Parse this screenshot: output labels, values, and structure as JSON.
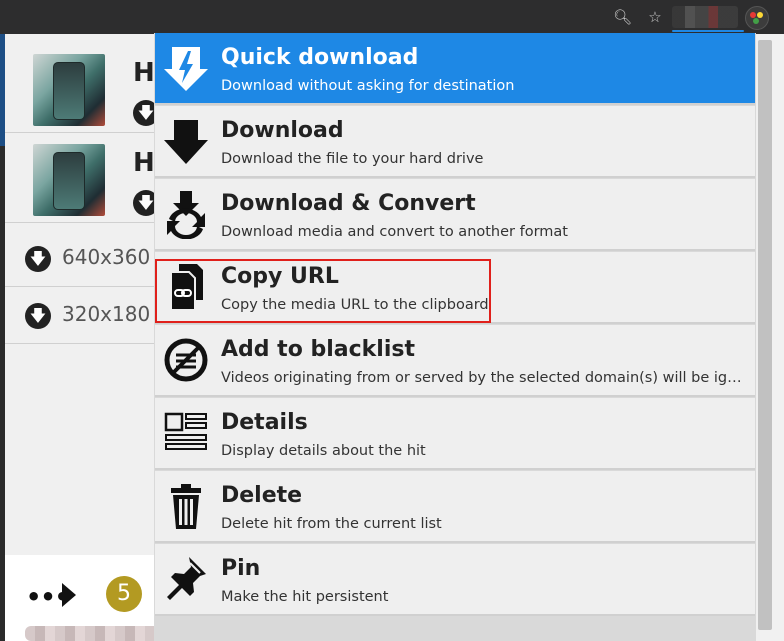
{
  "hits": [
    {
      "letter": "H"
    },
    {
      "letter": "H"
    }
  ],
  "variants": [
    {
      "label": "640x360"
    },
    {
      "label": "320x180"
    }
  ],
  "footer": {
    "badge_count": "5"
  },
  "menu": {
    "items": [
      {
        "title": "Quick download",
        "desc": "Download without asking for destination",
        "icon": "quick-download-icon"
      },
      {
        "title": "Download",
        "desc": "Download the file to your hard drive",
        "icon": "download-arrow-icon"
      },
      {
        "title": "Download & Convert",
        "desc": "Download media and convert to another format",
        "icon": "download-convert-icon"
      },
      {
        "title": "Copy URL",
        "desc": "Copy the media URL to the clipboard",
        "icon": "copy-url-icon"
      },
      {
        "title": "Add to blacklist",
        "desc": "Videos originating from or served by the selected domain(s) will be ignored",
        "icon": "blacklist-icon"
      },
      {
        "title": "Details",
        "desc": "Display details about the hit",
        "icon": "details-icon"
      },
      {
        "title": "Delete",
        "desc": "Delete hit from the current list",
        "icon": "trash-icon"
      },
      {
        "title": "Pin",
        "desc": "Make the hit persistent",
        "icon": "pin-icon"
      }
    ]
  },
  "colors": {
    "accent": "#1e88e5",
    "highlight_border": "#e0201b",
    "badge": "#b39a22"
  }
}
